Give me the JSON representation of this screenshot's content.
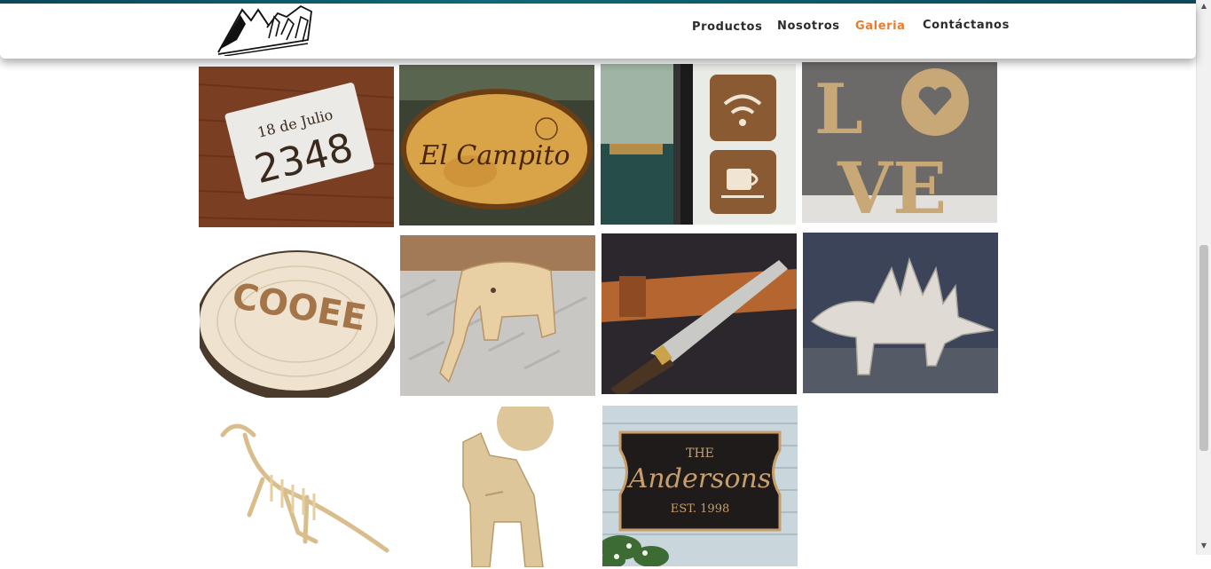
{
  "nav": {
    "items": [
      {
        "label": "Productos",
        "active": false
      },
      {
        "label": "Nosotros",
        "active": false
      },
      {
        "label": "Galeria",
        "active": true
      },
      {
        "label": "Contáctanos",
        "active": false
      }
    ],
    "active_color": "#ef7a2a"
  },
  "gallery": {
    "images": [
      {
        "name": "house-number-sign",
        "text_line1": "18 de Julio",
        "text_line2": "2348"
      },
      {
        "name": "el-campito-sign",
        "text": "El Campito"
      },
      {
        "name": "wifi-coffee-signs"
      },
      {
        "name": "love-letters",
        "text_top": "L",
        "text_bottom": "VE"
      },
      {
        "name": "cooee-carved-wood",
        "text": "COOEE"
      },
      {
        "name": "wooden-elephant"
      },
      {
        "name": "knife-leather-sheath"
      },
      {
        "name": "wooden-stegosaurus"
      },
      {
        "name": "wooden-dinosaur-skeleton"
      },
      {
        "name": "wooden-deer"
      },
      {
        "name": "andersons-sign",
        "text_line1": "THE",
        "text_line2": "Andersons",
        "text_line3": "EST. 1998"
      }
    ]
  }
}
